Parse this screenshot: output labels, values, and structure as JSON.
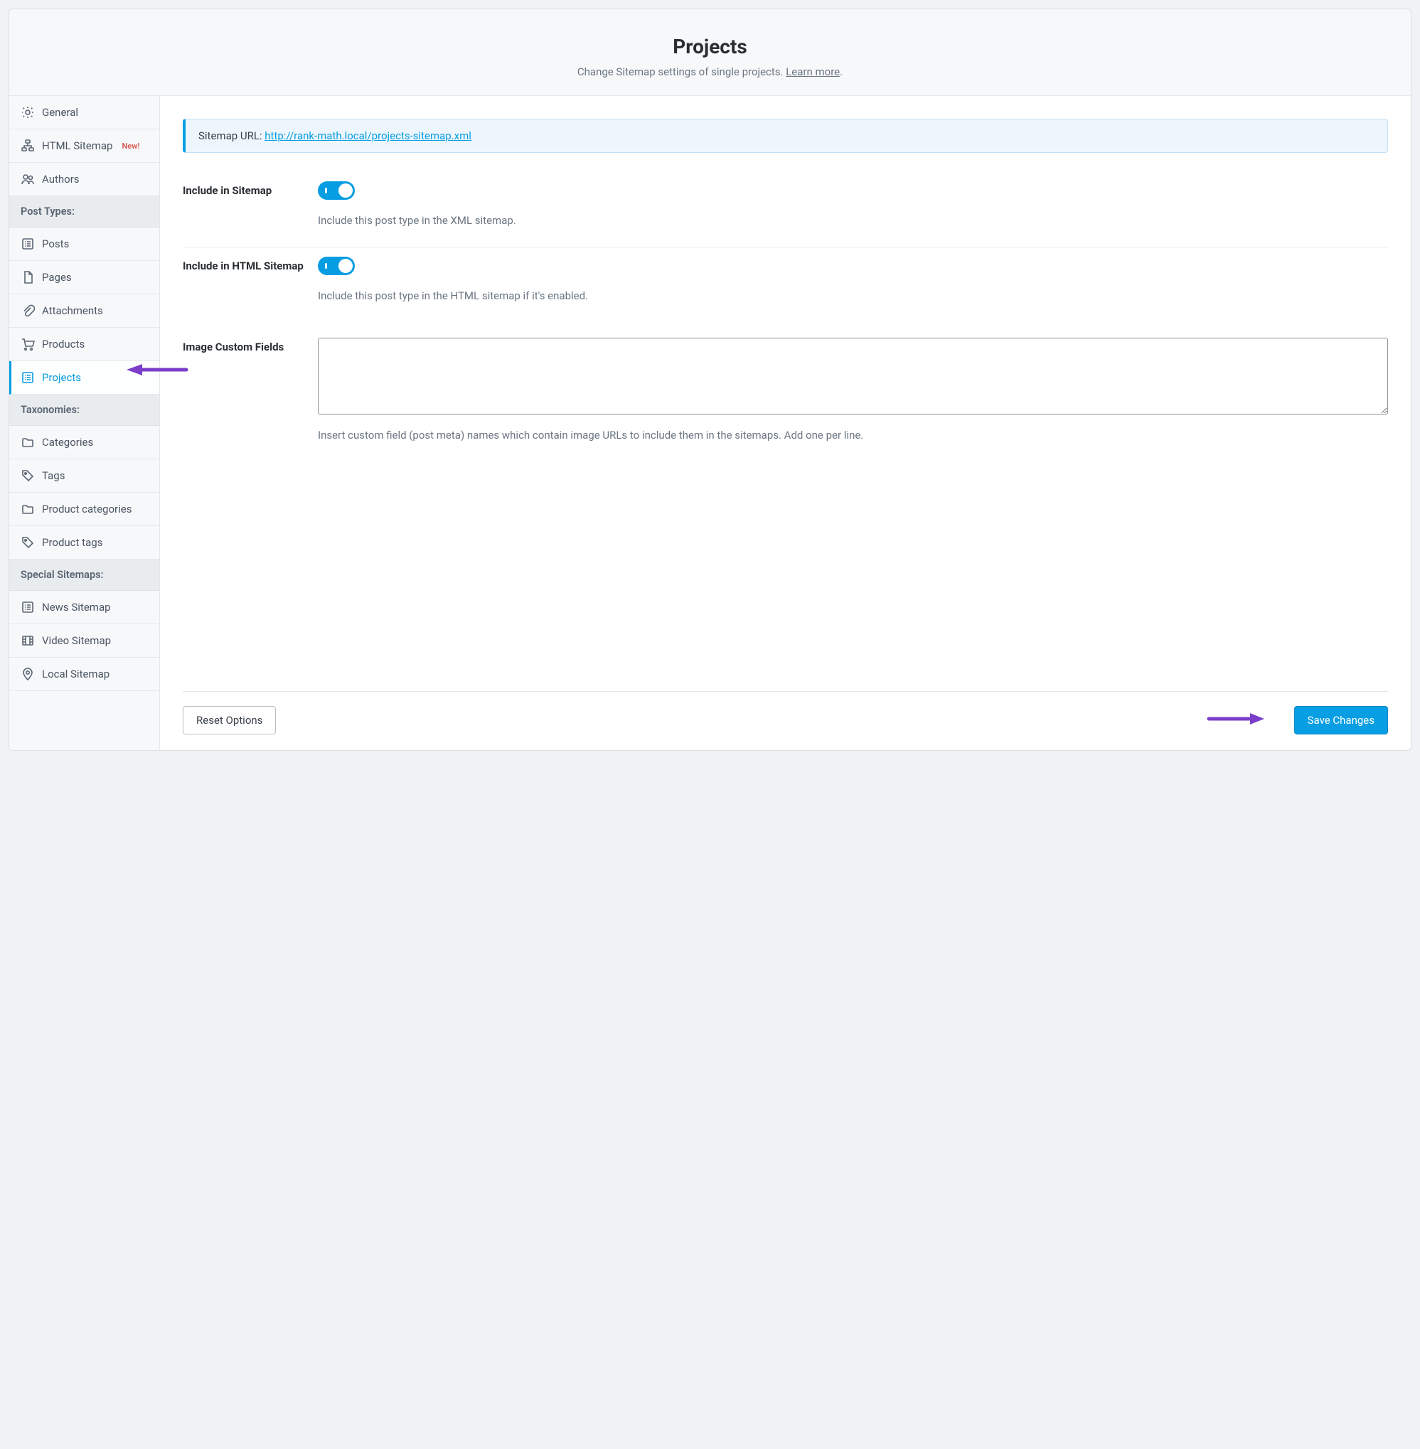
{
  "header": {
    "title": "Projects",
    "subtitle_prefix": "Change Sitemap settings of single projects. ",
    "subtitle_link": "Learn more",
    "subtitle_suffix": "."
  },
  "sidebar": {
    "items_top": [
      {
        "label": "General",
        "icon": "gear"
      },
      {
        "label": "HTML Sitemap",
        "icon": "tree",
        "badge": "New!"
      },
      {
        "label": "Authors",
        "icon": "users"
      }
    ],
    "section_post_types": "Post Types:",
    "items_post_types": [
      {
        "label": "Posts",
        "icon": "doc-list"
      },
      {
        "label": "Pages",
        "icon": "page"
      },
      {
        "label": "Attachments",
        "icon": "clip"
      },
      {
        "label": "Products",
        "icon": "cart"
      },
      {
        "label": "Projects",
        "icon": "doc-list",
        "active": true
      }
    ],
    "section_taxonomies": "Taxonomies:",
    "items_taxonomies": [
      {
        "label": "Categories",
        "icon": "folder"
      },
      {
        "label": "Tags",
        "icon": "tag"
      },
      {
        "label": "Product categories",
        "icon": "folder"
      },
      {
        "label": "Product tags",
        "icon": "tag"
      }
    ],
    "section_special": "Special Sitemaps:",
    "items_special": [
      {
        "label": "News Sitemap",
        "icon": "doc-list"
      },
      {
        "label": "Video Sitemap",
        "icon": "film"
      },
      {
        "label": "Local Sitemap",
        "icon": "pin"
      }
    ]
  },
  "notice": {
    "prefix": "Sitemap URL: ",
    "url": "http://rank-math.local/projects-sitemap.xml"
  },
  "settings": {
    "include_sitemap": {
      "label": "Include in Sitemap",
      "help": "Include this post type in the XML sitemap.",
      "on": true
    },
    "include_html_sitemap": {
      "label": "Include in HTML Sitemap",
      "help": "Include this post type in the HTML sitemap if it's enabled.",
      "on": true
    },
    "image_custom_fields": {
      "label": "Image Custom Fields",
      "value": "",
      "help": "Insert custom field (post meta) names which contain image URLs to include them in the sitemaps. Add one per line."
    }
  },
  "footer": {
    "reset": "Reset Options",
    "save": "Save Changes"
  }
}
